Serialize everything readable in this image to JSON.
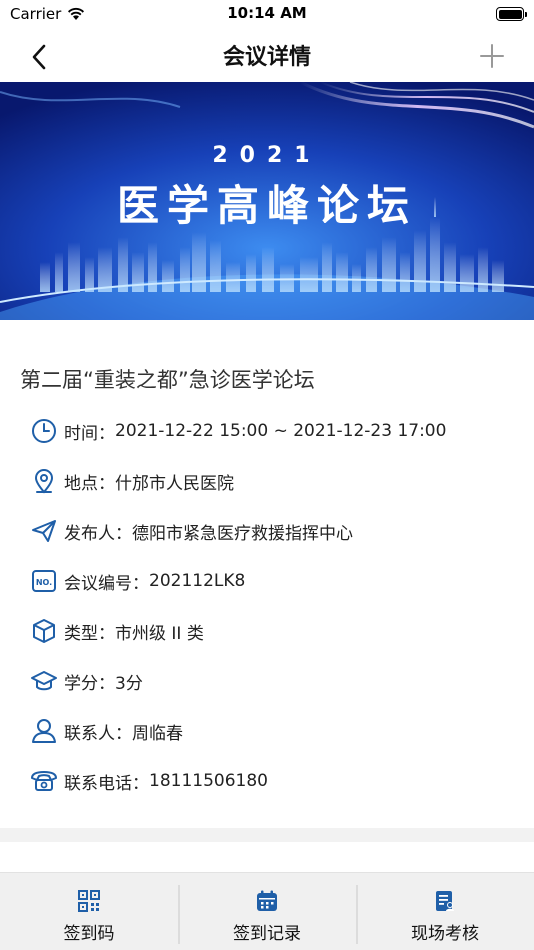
{
  "status_bar": {
    "carrier": "Carrier",
    "time": "10:14 AM"
  },
  "nav": {
    "title": "会议详情",
    "back_icon": "chevron-left-icon",
    "add_icon": "plus-icon"
  },
  "banner": {
    "year": "2021",
    "title": "医学高峰论坛"
  },
  "conference": {
    "title": "第二届“重装之都”急诊医学论坛",
    "details": [
      {
        "icon": "clock-icon",
        "label": "时间：",
        "value": "2021-12-22 15:00 ~ 2021-12-23 17:00"
      },
      {
        "icon": "location-pin-icon",
        "label": "地点：",
        "value": "什邡市人民医院"
      },
      {
        "icon": "paper-plane-icon",
        "label": "发布人：",
        "value": "德阳市紧急医疗救援指挥中心"
      },
      {
        "icon": "number-icon",
        "label": "会议编号：",
        "value": "202112LK8",
        "icon_text": "NO."
      },
      {
        "icon": "cube-icon",
        "label": "类型：",
        "value": "市州级 II 类"
      },
      {
        "icon": "graduation-cap-icon",
        "label": "学分：",
        "value": "3分"
      },
      {
        "icon": "person-icon",
        "label": "联系人：",
        "value": "周临春"
      },
      {
        "icon": "telephone-icon",
        "label": "联系电话：",
        "value": "18111506180"
      }
    ]
  },
  "tabs": [
    {
      "label": "签到码",
      "icon": "qr-code-icon"
    },
    {
      "label": "签到记录",
      "icon": "calendar-record-icon"
    },
    {
      "label": "现场考核",
      "icon": "assessment-icon"
    }
  ],
  "colors": {
    "accent": "#1f5fa8",
    "banner_dark": "#0a2a8a",
    "banner_light": "#2f7be0",
    "tab_bar": "#f0f0f0"
  }
}
